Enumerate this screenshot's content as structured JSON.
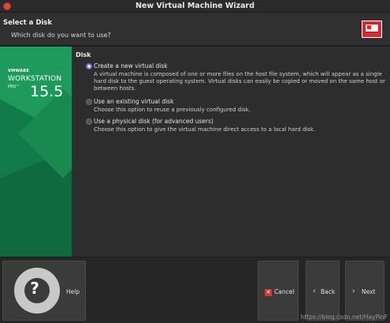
{
  "window": {
    "title": "New Virtual Machine Wizard"
  },
  "header": {
    "title": "Select a Disk",
    "subtitle": "Which disk do you want to use?",
    "icon": "vm-disk-icon"
  },
  "brand": {
    "vendor": "VMWARE",
    "product": "WORKSTATION",
    "edition": "PRO™",
    "version": "15.5",
    "color": "#127b4a"
  },
  "disk_group": {
    "label": "Disk",
    "options": [
      {
        "label": "Create a new virtual disk",
        "description": "A virtual machine is composed of one or more files on the host file system, which will appear as a single hard disk to the guest operating system. Virtual disks can easily be copied or moved on the same host or between hosts.",
        "selected": true
      },
      {
        "label": "Use an existing virtual disk",
        "description": "Choose this option to reuse a previously configured disk.",
        "selected": false
      },
      {
        "label": "Use a physical disk (for advanced users)",
        "description": "Choose this option to give the virtual machine direct access to a local hard disk.",
        "selected": false
      }
    ]
  },
  "buttons": {
    "help": "Help",
    "cancel": "Cancel",
    "back": "Back",
    "next": "Next"
  },
  "watermark": "https://blog.csdn.net/HayPinF"
}
